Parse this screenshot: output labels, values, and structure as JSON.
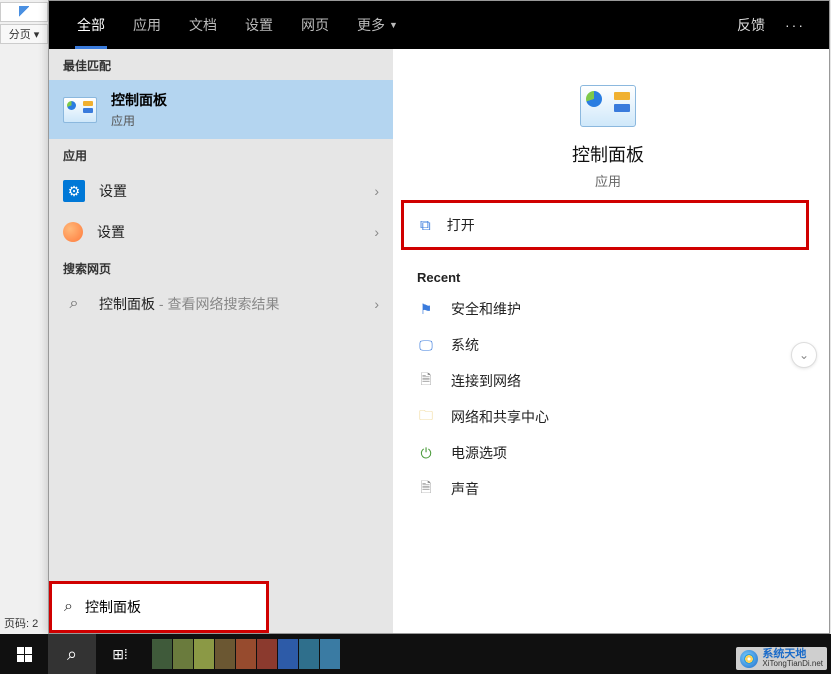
{
  "outside": {
    "paging_label": "分页 ▾",
    "page_number_label": "页码: 2"
  },
  "header": {
    "tabs": {
      "all": "全部",
      "apps": "应用",
      "docs": "文档",
      "settings": "设置",
      "web": "网页",
      "more": "更多"
    },
    "feedback": "反馈",
    "options": "···"
  },
  "left": {
    "best_match_label": "最佳匹配",
    "best_match": {
      "title": "控制面板",
      "subtitle": "应用"
    },
    "apps_label": "应用",
    "app_results": [
      {
        "icon": "gear-blue",
        "title": "设置"
      },
      {
        "icon": "gear-orange",
        "title": "设置"
      }
    ],
    "web_label": "搜索网页",
    "web_result": {
      "title": "控制面板",
      "hint": " - 查看网络搜索结果"
    }
  },
  "right": {
    "preview": {
      "title": "控制面板",
      "subtitle": "应用"
    },
    "open_action": "打开",
    "recent_label": "Recent",
    "recent": [
      {
        "icon": "flag",
        "label": "安全和维护"
      },
      {
        "icon": "monitor",
        "label": "系统"
      },
      {
        "icon": "file",
        "label": "连接到网络"
      },
      {
        "icon": "folder",
        "label": "网络和共享中心"
      },
      {
        "icon": "power",
        "label": "电源选项"
      },
      {
        "icon": "file",
        "label": "声音"
      }
    ]
  },
  "searchbox": {
    "value": "控制面板"
  },
  "watermark": {
    "top": "系统天地",
    "bottom": "XiTongTianDi.net"
  },
  "task_colors": [
    "#3f5a3a",
    "#6a7b3d",
    "#8b9945",
    "#6b5732",
    "#974b2e",
    "#8b3a2e",
    "#2d5ba8",
    "#2f6f8c",
    "#3a7ba3"
  ]
}
